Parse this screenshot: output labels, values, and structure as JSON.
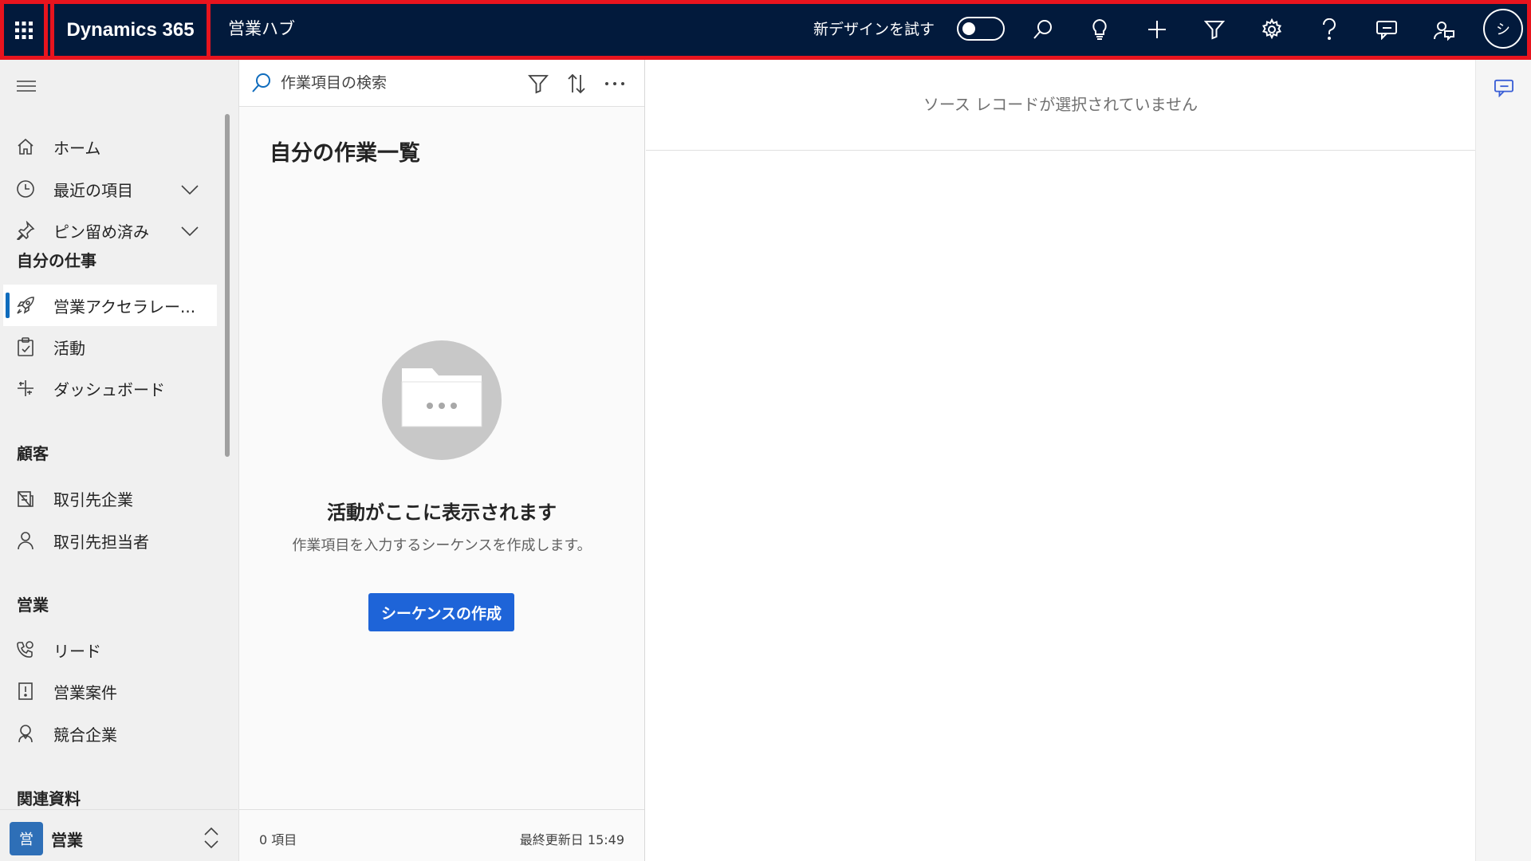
{
  "topbar": {
    "brand": "Dynamics 365",
    "app_name": "営業ハブ",
    "try_new_design": "新デザインを試す",
    "try_new_toggle_on": false,
    "avatar_initial": "シ",
    "highlight_color": "#e8141e",
    "background_color": "#021a3c",
    "icons": [
      "waffle-icon",
      "search-icon",
      "lightbulb-icon",
      "plus-icon",
      "filter-icon",
      "gear-icon",
      "help-icon",
      "chat-icon",
      "feedback-icon"
    ]
  },
  "sidebar": {
    "pinned": [
      {
        "label": "ホーム",
        "icon": "home-icon"
      },
      {
        "label": "最近の項目",
        "icon": "clock-icon",
        "expandable": true
      },
      {
        "label": "ピン留め済み",
        "icon": "pin-icon",
        "expandable": true
      }
    ],
    "sections": [
      {
        "title": "自分の仕事",
        "items": [
          {
            "label": "営業アクセラレー...",
            "icon": "rocket-icon",
            "selected": true
          },
          {
            "label": "活動",
            "icon": "clipboard-icon"
          },
          {
            "label": "ダッシュボード",
            "icon": "dashboard-icon"
          }
        ]
      },
      {
        "title": "顧客",
        "items": [
          {
            "label": "取引先企業",
            "icon": "building-icon"
          },
          {
            "label": "取引先担当者",
            "icon": "person-icon"
          }
        ]
      },
      {
        "title": "営業",
        "items": [
          {
            "label": "リード",
            "icon": "phone-icon"
          },
          {
            "label": "営業案件",
            "icon": "opportunity-icon"
          },
          {
            "label": "競合企業",
            "icon": "competitor-icon"
          }
        ]
      },
      {
        "title": "関連資料",
        "items": []
      }
    ],
    "area": {
      "badge": "営",
      "label": "営業",
      "badge_color": "#2e6fb7"
    },
    "accent_color": "#0f6cbd"
  },
  "worklist": {
    "search_placeholder": "作業項目の検索",
    "title": "自分の作業一覧",
    "empty_title": "活動がここに表示されます",
    "empty_subtitle": "作業項目を入力するシーケンスを作成します。",
    "create_button": "シーケンスの作成",
    "create_button_color": "#1e64d8",
    "item_count": "0 項目",
    "last_updated": "最終更新日 15:49"
  },
  "main": {
    "no_record": "ソース レコードが選択されていません"
  }
}
